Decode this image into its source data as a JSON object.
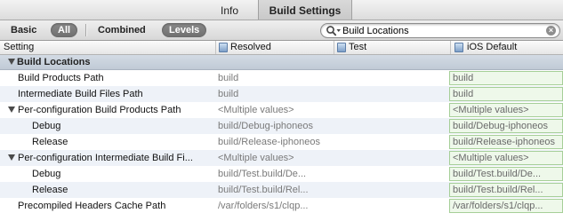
{
  "tabs": {
    "info": "Info",
    "build_settings": "Build Settings"
  },
  "filters": {
    "basic": "Basic",
    "all": "All",
    "combined": "Combined",
    "levels": "Levels"
  },
  "search": {
    "value": "Build Locations"
  },
  "columns": {
    "setting": "Setting",
    "resolved": "Resolved",
    "test": "Test",
    "ios_default": "iOS Default"
  },
  "group": {
    "title": "Build Locations"
  },
  "rows": [
    {
      "name": "Build Products Path",
      "resolved": "build",
      "ios": "build"
    },
    {
      "name": "Intermediate Build Files Path",
      "resolved": "build",
      "ios": "build"
    },
    {
      "name": "Per-configuration Build Products Path",
      "resolved": "<Multiple values>",
      "ios": "<Multiple values>"
    },
    {
      "name": "Debug",
      "resolved": "build/Debug-iphoneos",
      "ios": "build/Debug-iphoneos"
    },
    {
      "name": "Release",
      "resolved": "build/Release-iphoneos",
      "ios": "build/Release-iphoneos"
    },
    {
      "name": "Per-configuration Intermediate Build Fi...",
      "resolved": "<Multiple values>",
      "ios": "<Multiple values>"
    },
    {
      "name": "Debug",
      "resolved": "build/Test.build/De...",
      "ios": "build/Test.build/De..."
    },
    {
      "name": "Release",
      "resolved": "build/Test.build/Rel...",
      "ios": "build/Test.build/Rel..."
    },
    {
      "name": "Precompiled Headers Cache Path",
      "resolved": "/var/folders/s1/clqp...",
      "ios": "/var/folders/s1/clqp..."
    }
  ],
  "icons": {
    "search": "magnifier-dropdown-icon",
    "clear": "clear-search-icon",
    "target": "target-icon",
    "disclosure": "disclosure-triangle-icon"
  }
}
